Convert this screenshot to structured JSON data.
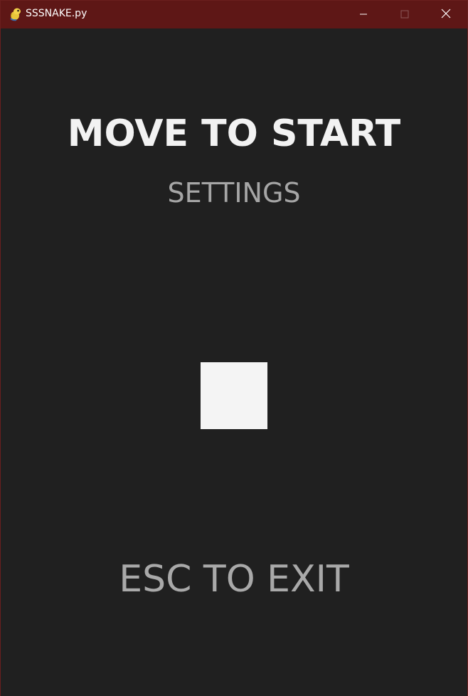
{
  "window": {
    "title": "SSSNAKE.py",
    "icon": "python-snake-icon",
    "titlebar_color": "#5e1716",
    "controls": [
      "minimize-icon",
      "maximize-icon",
      "close-icon"
    ]
  },
  "game": {
    "background_color": "#202020",
    "start_prompt": "MOVE TO START",
    "settings_label": "SETTINGS",
    "exit_prompt": "ESC TO EXIT",
    "player_color": "#f4f4f4"
  }
}
